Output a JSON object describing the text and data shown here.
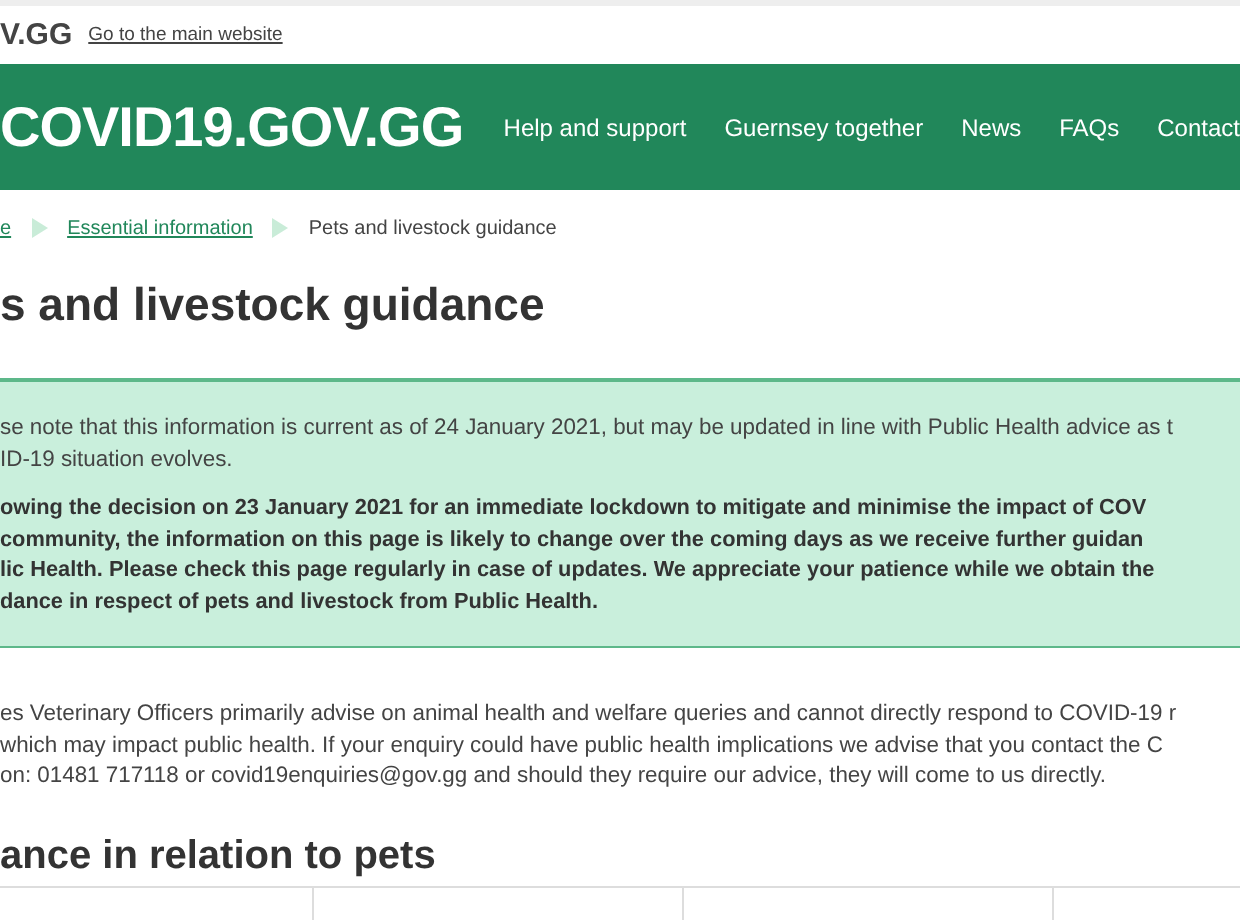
{
  "top_bar": {
    "logo": "V.GG",
    "link": "Go to the main website"
  },
  "header": {
    "logo": "COVID19.GOV.GG",
    "nav": [
      "Help and support",
      "Guernsey together",
      "News",
      "FAQs",
      "Contact"
    ]
  },
  "breadcrumb": [
    {
      "label": "e",
      "link": true
    },
    {
      "label": "Essential information",
      "link": true
    },
    {
      "label": "Pets and livestock guidance",
      "link": false
    }
  ],
  "title": "s and livestock guidance",
  "notice": {
    "lines": [
      "se note that this information is current as of 24 January 2021, but may be updated in line with Public Health advice as t",
      "ID-19 situation evolves."
    ],
    "bold_lines": [
      "owing the decision on 23 January 2021 for an immediate lockdown to mitigate and minimise the impact of COV",
      "community, the information on this page is likely to change over the coming days as we receive further guidan",
      "lic Health. Please check this page regularly in case of updates. We appreciate your patience while we obtain the",
      "dance in respect of pets and livestock from Public Health."
    ]
  },
  "body_lines": [
    "es Veterinary Officers primarily advise on animal health and welfare queries and cannot directly respond to COVID-19 r",
    "which may impact public health. If your enquiry could have public health implications we advise that you contact the C",
    "on: 01481 717118 or covid19enquiries@gov.gg and should they require our advice, they will come to us directly."
  ],
  "subheading": "ance in relation to pets"
}
